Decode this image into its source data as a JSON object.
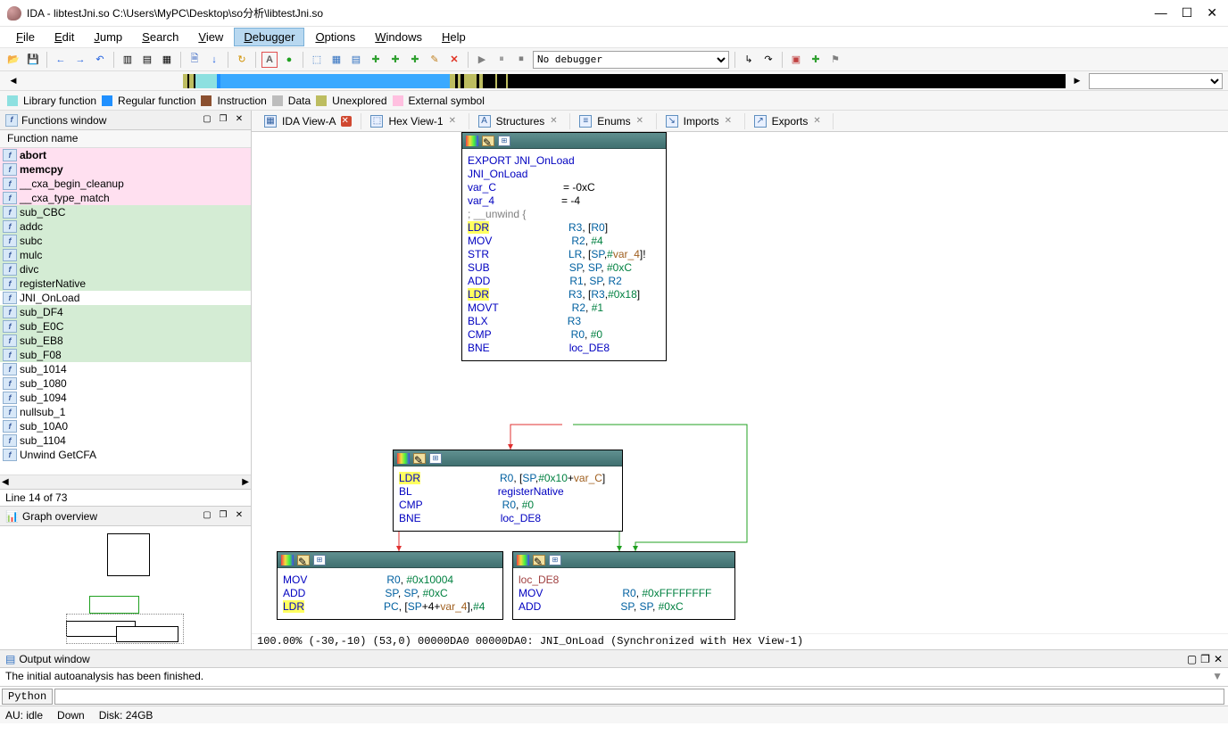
{
  "window": {
    "title": "IDA - libtestJni.so C:\\Users\\MyPC\\Desktop\\so分析\\libtestJni.so"
  },
  "menu": [
    "File",
    "Edit",
    "Jump",
    "Search",
    "View",
    "Debugger",
    "Options",
    "Windows",
    "Help"
  ],
  "menu_accel": [
    "F",
    "E",
    "J",
    "S",
    "V",
    "D",
    "O",
    "W",
    "H"
  ],
  "menu_active": 5,
  "toolbar": {
    "debugger_select": "No debugger"
  },
  "legend": [
    {
      "color": "#8de0e0",
      "label": "Library function"
    },
    {
      "color": "#2090ff",
      "label": "Regular function"
    },
    {
      "color": "#8b5030",
      "label": "Instruction"
    },
    {
      "color": "#bdbdbd",
      "label": "Data"
    },
    {
      "color": "#bdbd60",
      "label": "Unexplored"
    },
    {
      "color": "#ffc0e0",
      "label": "External symbol"
    }
  ],
  "functions": {
    "title": "Functions window",
    "col": "Function name",
    "line_info": "Line 14 of 73",
    "items": [
      {
        "name": "abort",
        "bg": "#ffe0f0",
        "bold": true
      },
      {
        "name": "memcpy",
        "bg": "#ffe0f0",
        "bold": true
      },
      {
        "name": "__cxa_begin_cleanup",
        "bg": "#ffe0f0"
      },
      {
        "name": "__cxa_type_match",
        "bg": "#ffe0f0"
      },
      {
        "name": "sub_CBC",
        "bg": "#d4ecd4"
      },
      {
        "name": "addc",
        "bg": "#d4ecd4"
      },
      {
        "name": "subc",
        "bg": "#d4ecd4"
      },
      {
        "name": "mulc",
        "bg": "#d4ecd4"
      },
      {
        "name": "divc",
        "bg": "#d4ecd4"
      },
      {
        "name": "registerNative",
        "bg": "#d4ecd4"
      },
      {
        "name": "JNI_OnLoad",
        "bg": "#ffffff",
        "sel": true
      },
      {
        "name": "sub_DF4",
        "bg": "#d4ecd4"
      },
      {
        "name": "sub_E0C",
        "bg": "#d4ecd4"
      },
      {
        "name": "sub_EB8",
        "bg": "#d4ecd4"
      },
      {
        "name": "sub_F08",
        "bg": "#d4ecd4"
      },
      {
        "name": "sub_1014",
        "bg": "#ffffff"
      },
      {
        "name": "sub_1080",
        "bg": "#ffffff"
      },
      {
        "name": "sub_1094",
        "bg": "#ffffff"
      },
      {
        "name": "nullsub_1",
        "bg": "#ffffff"
      },
      {
        "name": "sub_10A0",
        "bg": "#ffffff"
      },
      {
        "name": "sub_1104",
        "bg": "#ffffff"
      },
      {
        "name": "Unwind GetCFA",
        "bg": "#ffffff"
      }
    ]
  },
  "graph_overview": {
    "title": "Graph overview"
  },
  "tabs": [
    {
      "label": "IDA View-A",
      "active": true,
      "icon": "view"
    },
    {
      "label": "Hex View-1",
      "icon": "hex"
    },
    {
      "label": "Structures",
      "icon": "struct"
    },
    {
      "label": "Enums",
      "icon": "enum"
    },
    {
      "label": "Imports",
      "icon": "import"
    },
    {
      "label": "Exports",
      "icon": "export"
    }
  ],
  "graph": {
    "status": "100.00% (-30,-10) (53,0) 00000DA0 00000DA0: JNI_OnLoad (Synchronized with Hex View-1)",
    "node1": {
      "lines": [
        {
          "t": ""
        },
        {
          "t": "EXPORT JNI_OnLoad",
          "cls": "kw-nav"
        },
        {
          "t": "JNI_OnLoad",
          "cls": "kw-nav"
        },
        {
          "t": ""
        },
        {
          "op": "var_C",
          "arg": "= -0xC",
          "cls": "kw-green"
        },
        {
          "op": "var_4",
          "arg": "= -4",
          "cls": "kw-green"
        },
        {
          "t": ""
        },
        {
          "t": "; __unwind {",
          "cls": "kw-gray"
        },
        {
          "op": "LDR",
          "arg": "R3, [R0]",
          "hl": true
        },
        {
          "op": "MOV",
          "arg": "R2, #4"
        },
        {
          "op": "STR",
          "arg": "LR, [SP,#var_4]!",
          "var": "var_4"
        },
        {
          "op": "SUB",
          "arg": "SP, SP, #0xC"
        },
        {
          "op": "ADD",
          "arg": "R1, SP, R2"
        },
        {
          "op": "LDR",
          "arg": "R3, [R3,#0x18]",
          "hl": true
        },
        {
          "op": "MOVT",
          "arg": "R2, #1"
        },
        {
          "op": "BLX",
          "arg": "R3"
        },
        {
          "op": "CMP",
          "arg": "R0, #0"
        },
        {
          "op": "BNE",
          "arg": "loc_DE8",
          "tgt": true
        }
      ]
    },
    "node2": {
      "lines": [
        {
          "op": "LDR",
          "arg": "R0, [SP,#0x10+var_C]",
          "hl": true,
          "var": "var_C"
        },
        {
          "op": "BL",
          "arg": "registerNative",
          "tgt": true
        },
        {
          "op": "CMP",
          "arg": "R0, #0"
        },
        {
          "op": "BNE",
          "arg": "loc_DE8",
          "tgt": true
        }
      ]
    },
    "node3": {
      "lines": [
        {
          "op": "MOV",
          "arg": "R0, #0x10004"
        },
        {
          "op": "ADD",
          "arg": "SP, SP, #0xC"
        },
        {
          "op": "LDR",
          "arg": "PC, [SP+4+var_4],#4",
          "hl": true,
          "var": "var_4"
        }
      ]
    },
    "node4": {
      "lines": [
        {
          "t": ""
        },
        {
          "t": "loc_DE8",
          "cls": "kw-red"
        },
        {
          "op": "MOV",
          "arg": "R0, #0xFFFFFFFF"
        },
        {
          "op": "ADD",
          "arg": "SP, SP, #0xC"
        }
      ]
    }
  },
  "output": {
    "title": "Output window",
    "text": "The initial autoanalysis has been finished.",
    "cmd_label": "Python"
  },
  "status": {
    "au": "AU: idle",
    "down": "Down",
    "disk": "Disk: 24GB"
  },
  "nav_segments": [
    {
      "w": 15.2,
      "c": "#f6f6f6"
    },
    {
      "w": 0.4,
      "c": "#bdbd60"
    },
    {
      "w": 0.2,
      "c": "#000"
    },
    {
      "w": 0.4,
      "c": "#bdbd60"
    },
    {
      "w": 0.2,
      "c": "#000"
    },
    {
      "w": 2.0,
      "c": "#8de0e0"
    },
    {
      "w": 0.4,
      "c": "#2090ff"
    },
    {
      "w": 22.0,
      "c": "#3aa9ff"
    },
    {
      "w": 0.5,
      "c": "#bdbd60"
    },
    {
      "w": 0.3,
      "c": "#000"
    },
    {
      "w": 0.3,
      "c": "#bdbd60"
    },
    {
      "w": 0.3,
      "c": "#000"
    },
    {
      "w": 1.2,
      "c": "#bdbd60"
    },
    {
      "w": 0.3,
      "c": "#000"
    },
    {
      "w": 0.3,
      "c": "#bdbd60"
    },
    {
      "w": 1.2,
      "c": "#000"
    },
    {
      "w": 0.2,
      "c": "#bdbd60"
    },
    {
      "w": 0.8,
      "c": "#000"
    },
    {
      "w": 0.2,
      "c": "#bdbd60"
    },
    {
      "w": 0.2,
      "c": "#000"
    },
    {
      "w": 53.4,
      "c": "#000"
    }
  ]
}
